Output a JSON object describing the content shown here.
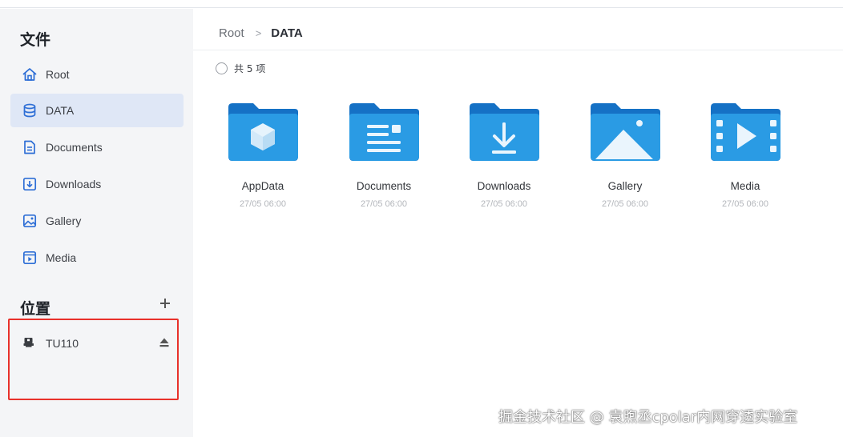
{
  "sidebar": {
    "files_title": "文件",
    "items": [
      {
        "label": "Root",
        "icon": "home-icon"
      },
      {
        "label": "DATA",
        "icon": "database-icon",
        "active": true
      },
      {
        "label": "Documents",
        "icon": "document-icon"
      },
      {
        "label": "Downloads",
        "icon": "download-icon"
      },
      {
        "label": "Gallery",
        "icon": "image-icon"
      },
      {
        "label": "Media",
        "icon": "video-icon"
      }
    ],
    "places_title": "位置",
    "devices": [
      {
        "label": "TU110",
        "icon": "usb-drive-icon",
        "action_icon": "eject-icon"
      }
    ]
  },
  "breadcrumb": {
    "root": "Root",
    "separator": ">",
    "current": "DATA"
  },
  "toolbar": {
    "count_label": "共 5 项"
  },
  "folders": [
    {
      "name": "AppData",
      "date": "27/05 06:00",
      "icon": "folder-cube-icon"
    },
    {
      "name": "Documents",
      "date": "27/05 06:00",
      "icon": "folder-document-icon"
    },
    {
      "name": "Downloads",
      "date": "27/05 06:00",
      "icon": "folder-download-icon"
    },
    {
      "name": "Gallery",
      "date": "27/05 06:00",
      "icon": "folder-image-icon"
    },
    {
      "name": "Media",
      "date": "27/05 06:00",
      "icon": "folder-video-icon"
    }
  ],
  "watermark": "掘金技术社区 @ 袁煦丞cpolar内网穿透实验室",
  "colors": {
    "accent": "#2f6fd6",
    "active_bg": "#dfe7f6",
    "folder_back": "#1571c5",
    "folder_front": "#2a9be4",
    "highlight_box": "#e8312b"
  }
}
